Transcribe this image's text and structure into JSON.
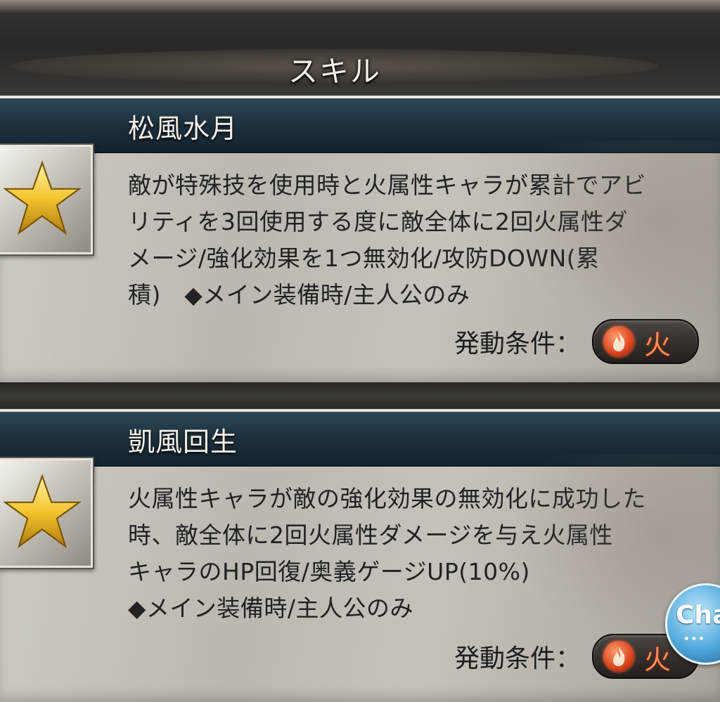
{
  "section": {
    "title": "スキル"
  },
  "skills": [
    {
      "name": "松風水月",
      "description_lines": [
        "敵が特殊技を使用時と火属性キャラが累計でアビ",
        "リティを3回使用する度に敵全体に2回火属性ダ",
        "メージ/強化効果を1つ無効化/攻防DOWN(累",
        "積)　◆メイン装備時/主人公のみ"
      ],
      "condition_label": "発動条件：",
      "element": "火",
      "element_icon": "fire-icon",
      "rank_icon": "gold-star-icon"
    },
    {
      "name": "凱風回生",
      "description_lines": [
        "火属性キャラが敵の強化効果の無効化に成功した",
        "時、敵全体に2回火属性ダメージを与え火属性",
        "キャラのHP回復/奥義ゲージUP(10%)",
        "◆メイン装備時/主人公のみ"
      ],
      "condition_label": "発動条件：",
      "element": "火",
      "element_icon": "fire-icon",
      "rank_icon": "gold-star-icon"
    }
  ],
  "chat_button": {
    "label": "Cha",
    "dots": "•••"
  },
  "colors": {
    "card_header": "#1a2d39",
    "fire_accent": "#ff8a52",
    "star_gold": "#f5c531"
  }
}
